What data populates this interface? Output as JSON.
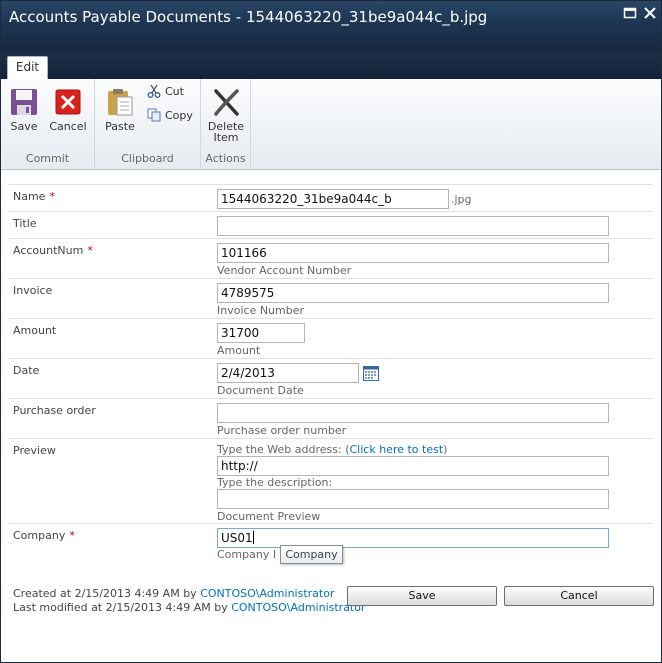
{
  "window": {
    "title": "Accounts Payable Documents - 1544063220_31be9a044c_b.jpg"
  },
  "ribbon": {
    "tab": "Edit",
    "commit": {
      "label": "Commit",
      "save": "Save",
      "cancel": "Cancel"
    },
    "clipboard": {
      "label": "Clipboard",
      "paste": "Paste",
      "cut": "Cut",
      "copy": "Copy"
    },
    "actions": {
      "label": "Actions",
      "delete_line1": "Delete",
      "delete_line2": "Item"
    }
  },
  "form": {
    "name": {
      "label": "Name",
      "value": "1544063220_31be9a044c_b",
      "suffix": ".jpg"
    },
    "title": {
      "label": "Title",
      "value": ""
    },
    "accountnum": {
      "label": "AccountNum",
      "value": "101166",
      "desc": "Vendor Account Number"
    },
    "invoice": {
      "label": "Invoice",
      "value": "4789575",
      "desc": "Invoice Number"
    },
    "amount": {
      "label": "Amount",
      "value": "31700",
      "desc": "Amount"
    },
    "date": {
      "label": "Date",
      "value": "2/4/2013",
      "desc": "Document Date"
    },
    "purchase_order": {
      "label": "Purchase order",
      "value": "",
      "desc": "Purchase order number"
    },
    "preview": {
      "label": "Preview",
      "web_prefix": "Type the Web address: (",
      "test_link": "Click here to test",
      "web_suffix": ")",
      "url_value": "http://",
      "desc_label": "Type the description:",
      "desc_value": "",
      "desc": "Document Preview"
    },
    "company": {
      "label": "Company",
      "value": "US01",
      "desc": "Company I",
      "tooltip": "Company"
    },
    "required_marker": "*"
  },
  "footer": {
    "created_prefix": "Created at 2/15/2013 4:49 AM by ",
    "created_by": "CONTOSO\\Administrator",
    "modified_prefix": "Last modified at 2/15/2013 4:49 AM by ",
    "modified_by": "CONTOSO\\Administrator",
    "save": "Save",
    "cancel": "Cancel"
  },
  "colors": {
    "accent": "#0072bc",
    "required": "#bf0000",
    "titlebar": "#1d3552"
  }
}
